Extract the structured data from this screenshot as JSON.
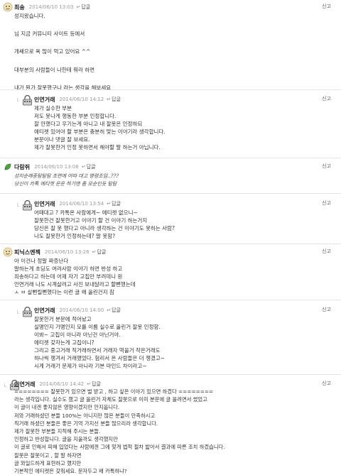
{
  "common": {
    "reply": "답글",
    "report": "신고",
    "indent": "└",
    "arrow": "↵"
  },
  "comments": [
    {
      "nick": "최송",
      "date": "2014/06/10 13:03",
      "lines": [
        "성지왔습니다.",
        "",
        "님 지금 커뮤니티 사이트 등에서",
        "",
        "개쌔으로 욕 많이 먹고 있어요 ^^",
        "",
        "대부분의 사람들이 나한테 뭐라 하면",
        "",
        "내가 뭔가 잘못했구나 라는 생각을 해보세요"
      ]
    },
    {
      "nick": "인연거래",
      "date": "2014/06/10 14:12",
      "lines": [
        "제가 실수한 부분",
        "저도 못나게 행동한 부분 인정합니다.",
        "잘 안했다고 우기는게 아니고 내 잘못은 인정하되",
        "에티켓 있어야 할 부분은 충분히 맞는 이야기라 생각합니다.",
        "분문이나 댓글 잘 보세요.",
        "제가 잘못한거 인정 못하면서 해야할 말 하는거 아닙니다."
      ]
    },
    {
      "nick": "다람쥐",
      "date": "2014/06/10 13:08",
      "lines": [
        "성지순례중탐탐탐 초면에 어따 대고 명령조임..???",
        "당신이 카톡 에티켓 운운 하기엔 좀 모순인듯 탐탐"
      ]
    },
    {
      "nick": "인연거래",
      "date": "2014/06/10 13:54",
      "lines": [
        "어때대고 ? 카톡온 사람에게~ 에티켓 없으니~",
        "잘못한건 잘못한거고 이야기 할 건 이야기 하는거지",
        "당신은 잘 못 했다고 아니라 생각하는 건 이야기도 못하는 사람?",
        "나도 잘못한거 인정하는데? 말 못함?"
      ]
    },
    {
      "nick": "피닉스엔젝",
      "date": "2014/06/10 13:26",
      "lines": [
        "아 이건나 정말 짜증난다",
        "말하는게 초딩도 여러사람 이야기 하면 반성 하고",
        "죄송하다고 하는데 어제 자기 고집만 부려데니 원",
        "인연거래 나도 시계살려고 사진 보내달라고 할뻔했는데",
        "ㅅ ㅂ 살뻔릴뻔했다는 이런 글 왜 올린건지 참"
      ]
    },
    {
      "nick": "인연거래",
      "date": "2014/06/10 14:00",
      "lines": [
        "잘못한거 분문에 적어놨고",
        "실명인지 가명인지 모를 이름 실수로 올린거 잘못 인정함.",
        "이봐~ 고집이 아니라 아닌건 아닌거야.",
        "에티켓 갖자는게 고집이니?",
        "그리고 중고거래 직거래하면서 거래자 먹을거 작은거래도",
        "하나씩 챙겨서 거래했었다. 험리서 온 사람들은 더 챙겼고~",
        "시계 거래가 문제가 아니라 기본 마인드 차이라고~"
      ]
    },
    {
      "nick": "인연거래",
      "date": "2014/06/10 14:42",
      "lines": [
        "======== 잘못한거 있으면 벌 받고 , 하고 싶은 이야기 있으면 하겠다 ========",
        "라는 생각입니다. 실수도 했고 글 올린거 자체도 잘못으로 이미 분문에 글 올려면서 썼었고",
        "이 글이 내겐 좋지않은 영향이겠지만 안지웁니다.",
        "저와 거래하셨던 분들 100%는 아니지만 많은 분들이 만족하시고",
        "직거래 하셨던 분들은 좋은 기억 가지신 분들 많으리라 생각합니다.",
        "제가 잘못한 부분들 지적해 주시는 분들.",
        "인정하고 반성합니다. 글을 지울까도 생각했지만",
        "이 글로 인해서 피해 입었다는 사람에겐 그에 맞게 법적 절차 밟아서 결과에 따른 조치 하겠습니다.",
        "잘못은 잘못이고 , 할 말 하자면",
        "글 와일드하게 표현하고 했지만",
        "기본적인 에티켓은 갖춰세요. 문자두고 왜 카톡하냐?"
      ]
    }
  ]
}
